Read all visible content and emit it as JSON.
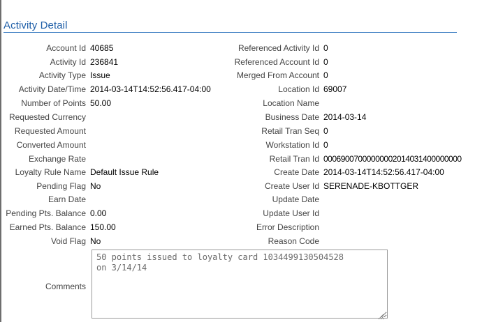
{
  "title": "Activity Detail",
  "left_fields": [
    {
      "label": "Account Id",
      "value": "40685"
    },
    {
      "label": "Activity Id",
      "value": "236841"
    },
    {
      "label": "Activity Type",
      "value": "Issue"
    },
    {
      "label": "Activity Date/Time",
      "value": "2014-03-14T14:52:56.417-04:00"
    },
    {
      "label": "Number of Points",
      "value": "50.00"
    },
    {
      "label": "Requested Currency",
      "value": ""
    },
    {
      "label": "Requested Amount",
      "value": ""
    },
    {
      "label": "Converted Amount",
      "value": ""
    },
    {
      "label": "Exchange Rate",
      "value": ""
    },
    {
      "label": "Loyalty Rule Name",
      "value": "Default Issue Rule"
    },
    {
      "label": "Pending Flag",
      "value": "No"
    },
    {
      "label": "Earn Date",
      "value": ""
    },
    {
      "label": "Pending Pts. Balance",
      "value": "0.00"
    },
    {
      "label": "Earned Pts. Balance",
      "value": "150.00"
    },
    {
      "label": "Void Flag",
      "value": "No"
    }
  ],
  "right_fields": [
    {
      "label": "Referenced Activity Id",
      "value": "0"
    },
    {
      "label": "Referenced Account Id",
      "value": "0"
    },
    {
      "label": "Merged From Account",
      "value": "0"
    },
    {
      "label": "Location Id",
      "value": "69007"
    },
    {
      "label": "Location Name",
      "value": ""
    },
    {
      "label": "Business Date",
      "value": "2014-03-14"
    },
    {
      "label": "Retail Tran Seq",
      "value": "0"
    },
    {
      "label": "Workstation Id",
      "value": "0"
    },
    {
      "label": "Retail Tran Id",
      "value": "00069007000000002014031400000000"
    },
    {
      "label": "Create Date",
      "value": "2014-03-14T14:52:56.417-04:00"
    },
    {
      "label": "Create User Id",
      "value": "SERENADE-KBOTTGER"
    },
    {
      "label": "Update Date",
      "value": ""
    },
    {
      "label": "Update User Id",
      "value": ""
    },
    {
      "label": "Error Description",
      "value": ""
    },
    {
      "label": "Reason Code",
      "value": ""
    }
  ],
  "comments": {
    "label": "Comments",
    "value": "50 points issued to loyalty card 1034499130504528\non 3/14/14"
  }
}
